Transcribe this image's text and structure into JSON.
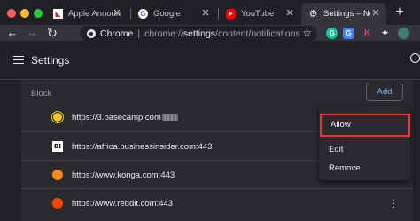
{
  "tabs": [
    {
      "label": "Apple Announ",
      "favicon": "brand-favicon"
    },
    {
      "label": "Google",
      "favicon": "google-favicon"
    },
    {
      "label": "YouTube",
      "favicon": "youtube-favicon"
    },
    {
      "label": "Settings – Not",
      "favicon": "settings-gear-icon",
      "active": true
    }
  ],
  "newtab_symbol": "+",
  "omnibox": {
    "chrome_label": "Chrome",
    "url_base": "chrome://",
    "url_path": "settings",
    "url_rest": "/content/notifications"
  },
  "extensions": [
    {
      "name": "grammarly-extension-icon",
      "glyph": "G",
      "color": "#15c39a"
    },
    {
      "name": "translate-extension-icon",
      "glyph": "G",
      "color": "#4285f4"
    },
    {
      "name": "k-extension-icon",
      "glyph": "K",
      "color": "#d93a7a"
    },
    {
      "name": "puzzle-extension-icon",
      "glyph": "✦",
      "color": "#5f6368"
    },
    {
      "name": "profile-avatar",
      "glyph": "",
      "color": "#3c7f72"
    }
  ],
  "settings": {
    "title": "Settings",
    "section_label": "Block",
    "add_label": "Add",
    "sites": [
      {
        "url": "https://3.basecamp.com",
        "redacted": true,
        "icon": "basecamp-favicon"
      },
      {
        "url": "https://africa.businessinsider.com:443",
        "icon": "businessinsider-favicon"
      },
      {
        "url": "https://www.konga.com:443",
        "icon": "konga-favicon"
      },
      {
        "url": "https://www.reddit.com:443",
        "icon": "reddit-favicon"
      }
    ]
  },
  "context_menu": {
    "items": [
      "Allow",
      "Edit",
      "Remove"
    ],
    "highlight_color": "#e53935"
  },
  "colors": {
    "accent_blue": "#8ab4f8",
    "traffic_close": "#ff5f57",
    "traffic_min": "#febc2e",
    "traffic_max": "#28c840"
  }
}
